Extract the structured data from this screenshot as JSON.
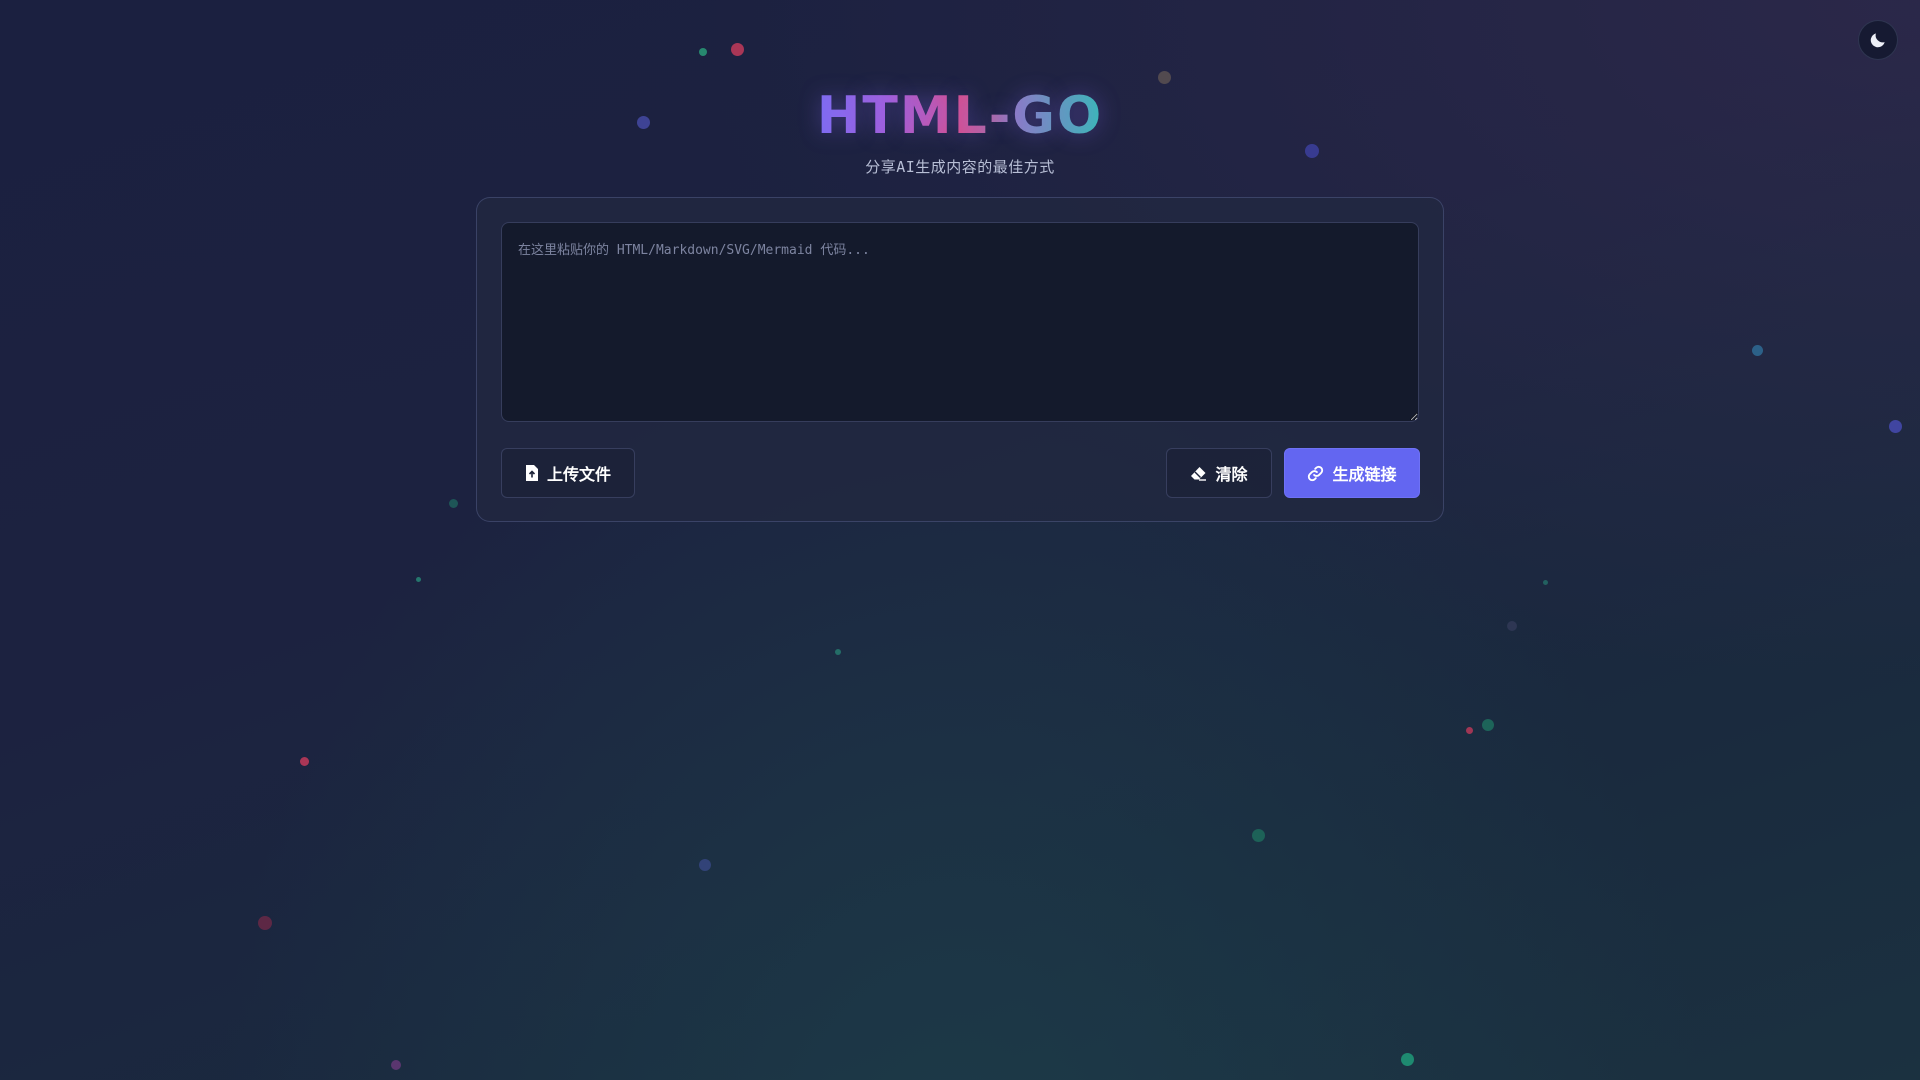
{
  "header": {
    "logo": "HTML-GO",
    "subtitle": "分享AI生成内容的最佳方式"
  },
  "editor": {
    "value": "",
    "placeholder": "在这里粘贴你的 HTML/Markdown/SVG/Mermaid 代码..."
  },
  "actions": {
    "upload_label": "上传文件",
    "clear_label": "清除",
    "generate_label": "生成链接"
  },
  "icons": {
    "theme_toggle": "moon-icon",
    "upload": "file-upload-icon",
    "clear": "eraser-icon",
    "generate": "link-icon"
  },
  "colors": {
    "accent": "#6366f1",
    "logo_gradient": [
      "#7c6cf0",
      "#d84f8a",
      "#31c0b0"
    ],
    "background": "#1c2240"
  }
}
